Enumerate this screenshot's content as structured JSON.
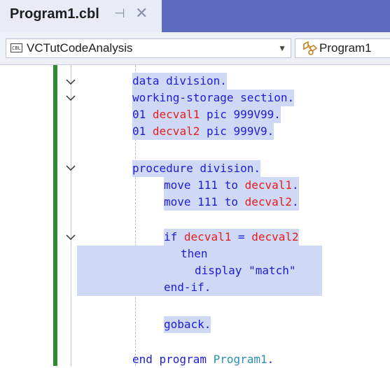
{
  "tab": {
    "title": "Program1.cbl",
    "pin_glyph": "⊣",
    "close_glyph": "✕"
  },
  "navbar": {
    "project_icon_text": "CBL",
    "project": "VCTutCodeAnalysis",
    "member": "Program1"
  },
  "code": {
    "l1": "data division.",
    "l2": "working-storage section.",
    "l3a": "01 ",
    "l3b": "decval1",
    "l3c": " pic 999V99.",
    "l4a": "01 ",
    "l4b": "decval2",
    "l4c": " pic 999V9.",
    "l5": "procedure division.",
    "l6a": "move 111 to ",
    "l6b": "decval1",
    "l6c": ".",
    "l7a": "move 111 to ",
    "l7b": "decval2",
    "l7c": ".",
    "l8a": "if ",
    "l8b": "decval1",
    "l8c": " = ",
    "l8d": "decval2",
    "l9": "then",
    "l10": "display \"match\"",
    "l11": "end-if.",
    "l12": "goback.",
    "l13a": "end program ",
    "l13b": "Program1",
    "l13c": "."
  },
  "colors": {
    "keyword": "#1d1dd6",
    "variable": "#e51e1e",
    "program_name": "#2b91af",
    "change_bar": "#2e8b2e",
    "selection": "#cfd9f5"
  }
}
